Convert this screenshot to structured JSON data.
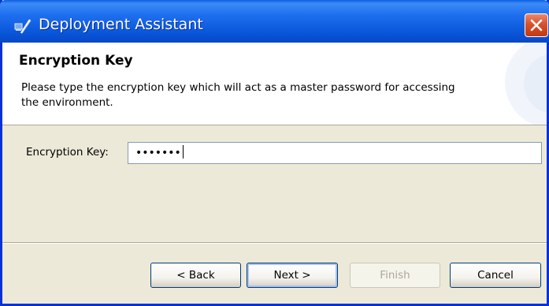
{
  "window": {
    "title": "Deployment Assistant",
    "app_icon": "deployment-assistant-icon",
    "close_icon": "close-icon"
  },
  "header": {
    "title": "Encryption Key",
    "description": "Please type the encryption key which will act as a master password for accessing the environment."
  },
  "form": {
    "encryption_key_label": "Encryption Key:",
    "encryption_key_value_masked": "•••••••"
  },
  "buttons": {
    "back": "< Back",
    "next": "Next >",
    "finish": "Finish",
    "cancel": "Cancel"
  },
  "colors": {
    "titlebar": "#0A5EE0",
    "window_frame": "#0831D9",
    "dialog_background": "#ECE9D8",
    "close_button": "#D8512D"
  }
}
